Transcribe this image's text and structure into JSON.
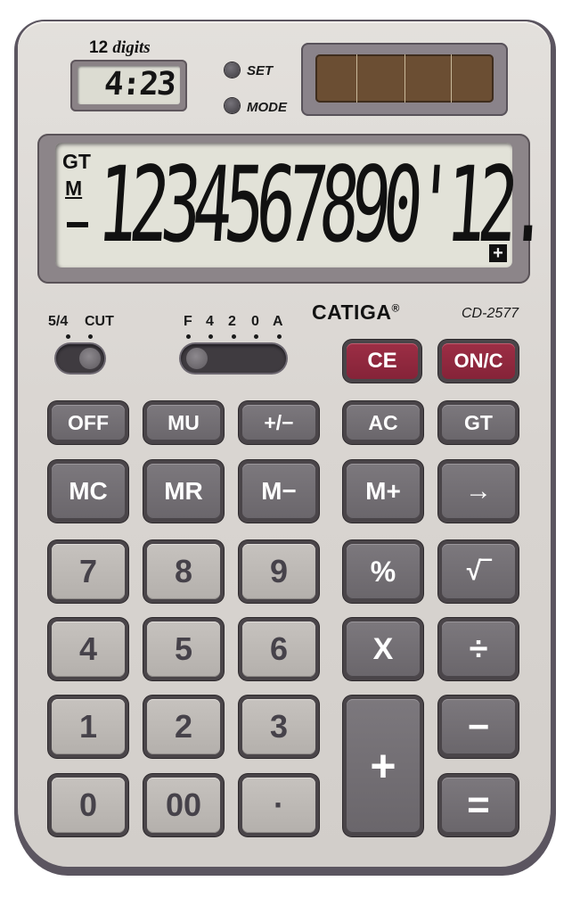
{
  "device": {
    "brand": "CATIGA",
    "brand_mark": "®",
    "model": "CD-2577",
    "digits_count": "12",
    "digits_word": "digits"
  },
  "clock": {
    "time": "4:23",
    "set_label": "SET",
    "mode_label": "MODE"
  },
  "display": {
    "gt_indicator": "GT",
    "memory_indicator": "M",
    "minus_indicator_shown": true,
    "value": "1234567890'12.",
    "sign_indicator": "+"
  },
  "switches": {
    "rounding": {
      "labels": [
        "5/4",
        "CUT"
      ],
      "selected": "CUT"
    },
    "decimal": {
      "labels": [
        "F",
        "4",
        "2",
        "0",
        "A"
      ],
      "selected": "F"
    }
  },
  "keys": {
    "row0": [
      "CE",
      "ON/C"
    ],
    "row1": [
      "OFF",
      "MU",
      "+/−",
      "AC",
      "GT"
    ],
    "row2": [
      "MC",
      "MR",
      "M−",
      "M+",
      "→"
    ],
    "row3": [
      "7",
      "8",
      "9",
      "%",
      "√‾"
    ],
    "row4": [
      "4",
      "5",
      "6",
      "X",
      "÷"
    ],
    "row5": [
      "1",
      "2",
      "3",
      "+",
      "−"
    ],
    "row6": [
      "0",
      "00",
      "·",
      "="
    ]
  },
  "colors": {
    "red_key": "#8d2840",
    "dark_key": "#716d72",
    "light_key": "#bcb8b4",
    "lcd": "#e2e2d8",
    "body": "#dcd8d4"
  }
}
